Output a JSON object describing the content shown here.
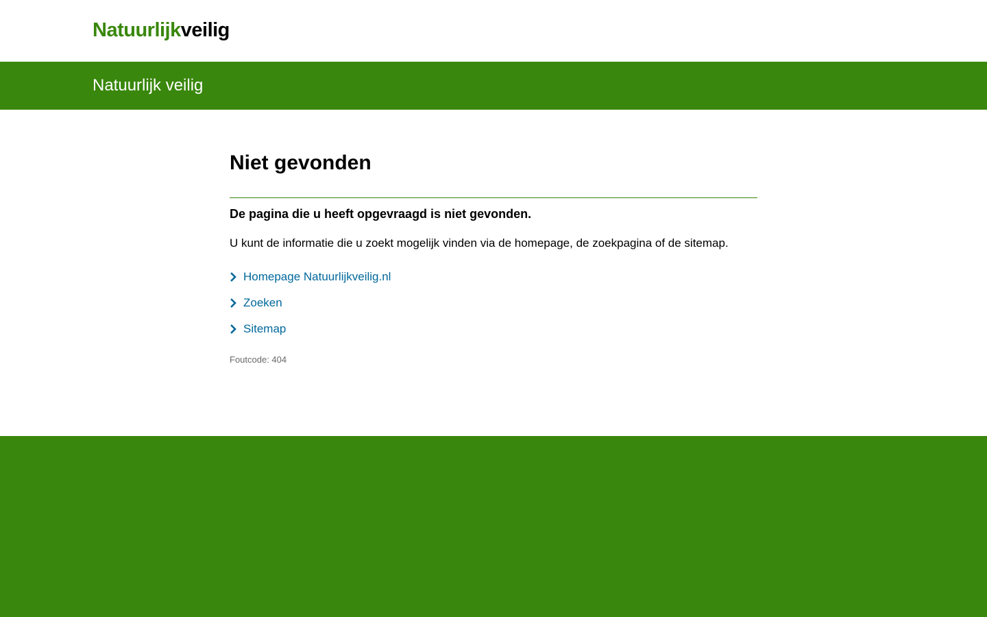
{
  "header": {
    "logo_part1": "Natuurlijk",
    "logo_part2": "veilig"
  },
  "banner": {
    "title": "Natuurlijk veilig"
  },
  "main": {
    "title": "Niet gevonden",
    "lead": "De pagina die u heeft opgevraagd is niet gevonden.",
    "intro": "U kunt de informatie die u zoekt mogelijk vinden via de homepage, de zoekpagina of de sitemap.",
    "links": [
      {
        "label": "Homepage Natuurlijkveilig.nl",
        "icon": "chevron-right-icon"
      },
      {
        "label": "Zoeken",
        "icon": "chevron-right-icon"
      },
      {
        "label": "Sitemap",
        "icon": "chevron-right-icon"
      }
    ],
    "error_code": "Foutcode: 404"
  },
  "colors": {
    "brand_green": "#39870c",
    "link_blue": "#01689b",
    "muted_gray": "#696969"
  }
}
